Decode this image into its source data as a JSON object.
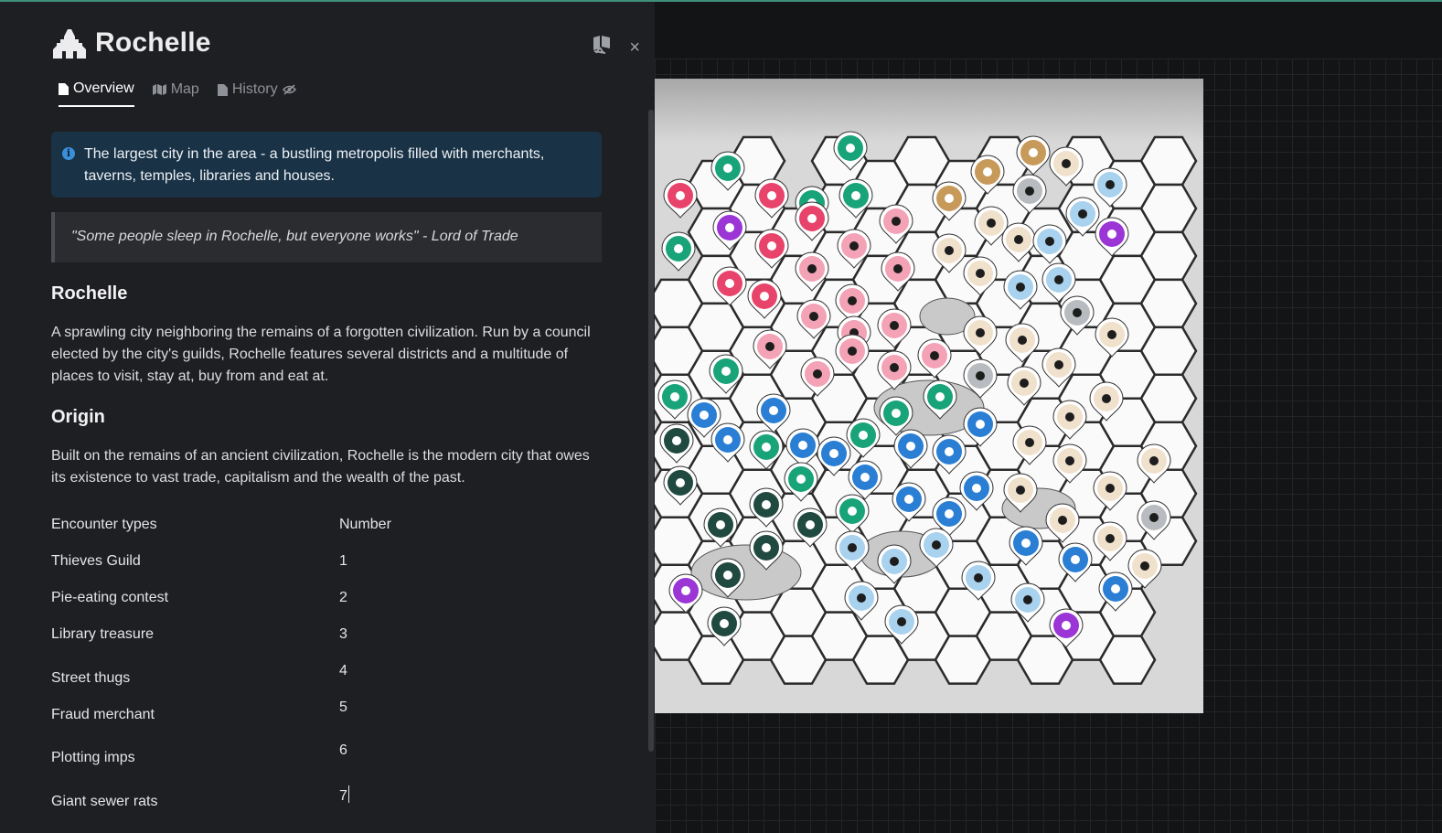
{
  "location": {
    "title": "Rochelle",
    "title_icon": "city-icon"
  },
  "panel_actions": {
    "pin_icon": "map-pin-off-icon",
    "close_label": "×"
  },
  "tabs": [
    {
      "label": "Overview",
      "icon": "document-icon",
      "active": true
    },
    {
      "label": "Map",
      "icon": "map-icon",
      "active": false
    },
    {
      "label": "History",
      "icon": "document-icon",
      "suffix_icon": "eye-off-icon",
      "active": false
    }
  ],
  "info": {
    "icon": "info-icon",
    "text": "The largest city in the area - a bustling metropolis filled with merchants, taverns, temples, libraries and houses."
  },
  "quote": "\"Some people sleep in Rochelle, but everyone works\" - Lord of Trade",
  "sections": {
    "heading1": "Rochelle",
    "para1": "A sprawling city neighboring the remains of a forgotten civilization. Run by a council elected by the city's guilds, Rochelle features several districts and a multitude of places to visit, stay at, buy from and eat at.",
    "heading2": "Origin",
    "para2": "Built on the remains of an ancient civilization, Rochelle is the modern city that owes its existence to vast trade, capitalism and the wealth of the past."
  },
  "encounters": {
    "col1": "Encounter types",
    "col2": "Number",
    "rows": [
      {
        "type": "Thieves Guild",
        "number": "1"
      },
      {
        "type": "Pie-eating contest",
        "number": "2"
      },
      {
        "type": "Library treasure",
        "number": "3"
      },
      {
        "type": "Street thugs",
        "number": "4"
      },
      {
        "type": "Fraud merchant",
        "number": "5"
      },
      {
        "type": "Plotting imps",
        "number": "6"
      },
      {
        "type": "Giant sewer rats",
        "number": "7"
      }
    ]
  },
  "map": {
    "marker_colors": {
      "pink": "#e8436a",
      "rose": "#f3a3b5",
      "green": "#19a378",
      "darkgreen": "#20493f",
      "blue": "#2a7fd4",
      "lightblue": "#a9d2ef",
      "tan": "#f0e1cc",
      "gold": "#c89a5a",
      "purple": "#9b35d6",
      "gray": "#b8bcc0"
    },
    "marker_types": [
      "leaf-icon",
      "map-icon",
      "castle-icon",
      "hut-icon",
      "cactus-icon",
      "icicle-icon",
      "wave-icon",
      "fish-icon",
      "whale-icon",
      "spider-icon",
      "arch-icon",
      "snow-cloud-icon",
      "temple-icon",
      "shrine-icon"
    ]
  }
}
